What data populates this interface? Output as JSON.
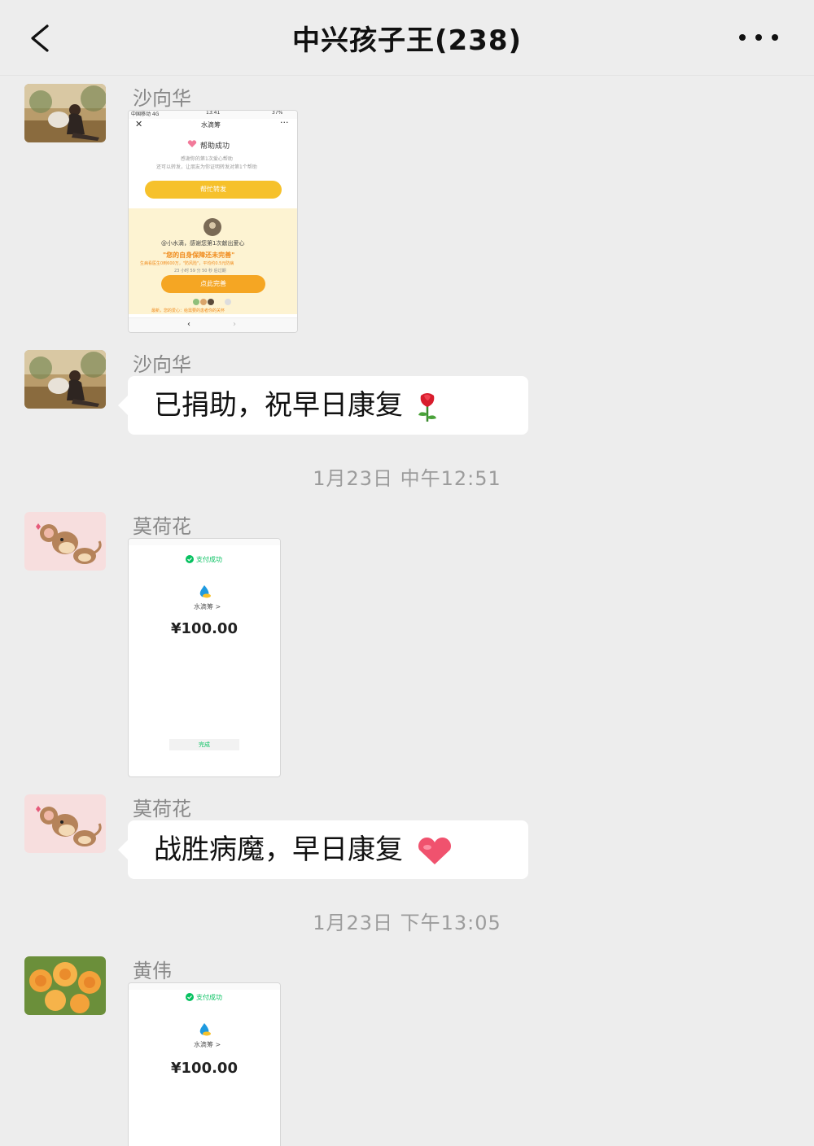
{
  "header": {
    "title": "中兴孩子王(238)"
  },
  "messages": [
    {
      "sender": "沙向华",
      "type": "image",
      "shot": {
        "carrier": "中国移动 4G",
        "time": "13:41",
        "battery": "37%",
        "page_title": "水滴筹",
        "success_label": "帮助成功",
        "line1": "感谢你的第1次爱心帮助",
        "line2": "还可以转发，让朋友为你证明转发对第1个帮助",
        "forward_button": "帮忙转发",
        "thanks": "@小水滴，感谢您第1次献出爱心",
        "slogan": "\"您的自身保障还未完善\"",
        "sub": "生病看医生0到600万，\"防风险\"，平均约0.5元防病",
        "countdown": "23 小时 59 分 50 秒 后过期",
        "perfect_button": "点此完善",
        "footer": "最新，您的爱心：给需要的患者你的关怀"
      }
    },
    {
      "sender": "沙向华",
      "type": "text",
      "text": "已捐助，祝早日康复",
      "emoji": "rose"
    },
    {
      "type": "time",
      "text": "1月23日 中午12:51"
    },
    {
      "sender": "莫荷花",
      "type": "image",
      "shot": {
        "status": "支付成功",
        "name": "水滴筹 >",
        "amount": "¥100.00",
        "done": "完成"
      }
    },
    {
      "sender": "莫荷花",
      "type": "text",
      "text": "战胜病魔，早日康复",
      "emoji": "heart"
    },
    {
      "type": "time",
      "text": "1月23日 下午13:05"
    },
    {
      "sender": "黄伟",
      "type": "image",
      "shot": {
        "status": "支付成功",
        "name": "水滴筹 >",
        "amount": "¥100.00"
      }
    }
  ],
  "colors": {
    "background": "#ededed",
    "bubble": "#ffffff",
    "accent_yellow": "#f6c12b",
    "accent_orange": "#f5a623",
    "wechat_green": "#07c160"
  }
}
